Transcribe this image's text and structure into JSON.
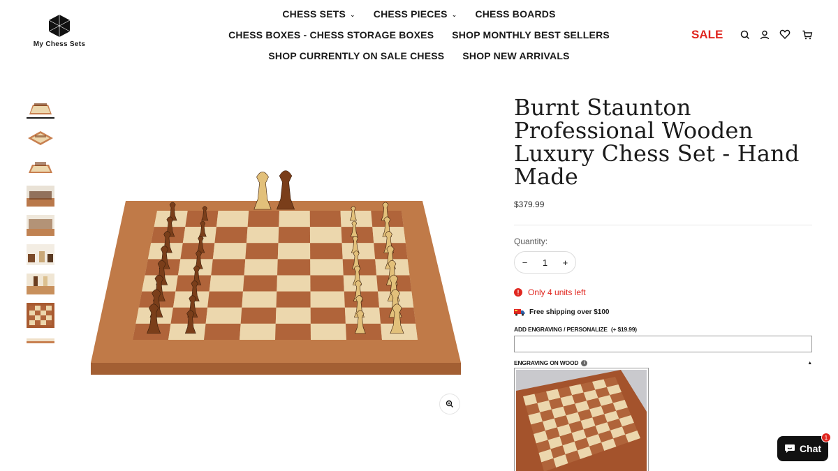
{
  "brand": {
    "name": "My Chess Sets",
    "logo_icon": "hexagon-cube-logo"
  },
  "nav": {
    "row1": [
      {
        "label": "CHESS SETS",
        "dropdown": true
      },
      {
        "label": "CHESS PIECES",
        "dropdown": true
      },
      {
        "label": "CHESS BOARDS",
        "dropdown": false
      }
    ],
    "row2": [
      {
        "label": "CHESS BOXES - CHESS STORAGE BOXES"
      },
      {
        "label": "SHOP MONTHLY BEST SELLERS"
      }
    ],
    "row3": [
      {
        "label": "SHOP CURRENTLY ON SALE CHESS"
      },
      {
        "label": "SHOP NEW ARRIVALS"
      }
    ],
    "sale": "SALE",
    "icons": [
      "search-icon",
      "account-icon",
      "wishlist-heart-icon",
      "cart-icon"
    ]
  },
  "product": {
    "title": "Burnt Staunton Professional Wooden Luxury Chess Set - Hand Made",
    "price": "$379.99",
    "quantity_label": "Quantity:",
    "quantity_value": "1",
    "qty_minus": "−",
    "qty_plus": "+",
    "stock_text": "Only 4 units left",
    "shipping_text": "Free shipping over $100",
    "engraving_label": "ADD ENGRAVING / PERSONALIZE",
    "engraving_price": "(+ $19.99)",
    "engraving_value": "",
    "wood_label": "ENGRAVING ON WOOD"
  },
  "chat": {
    "label": "Chat",
    "badge": "1"
  },
  "colors": {
    "sale": "#e0261f",
    "text": "#1a1a1a",
    "wood_dark": "#b0643a",
    "wood_light": "#ecd7ad"
  }
}
